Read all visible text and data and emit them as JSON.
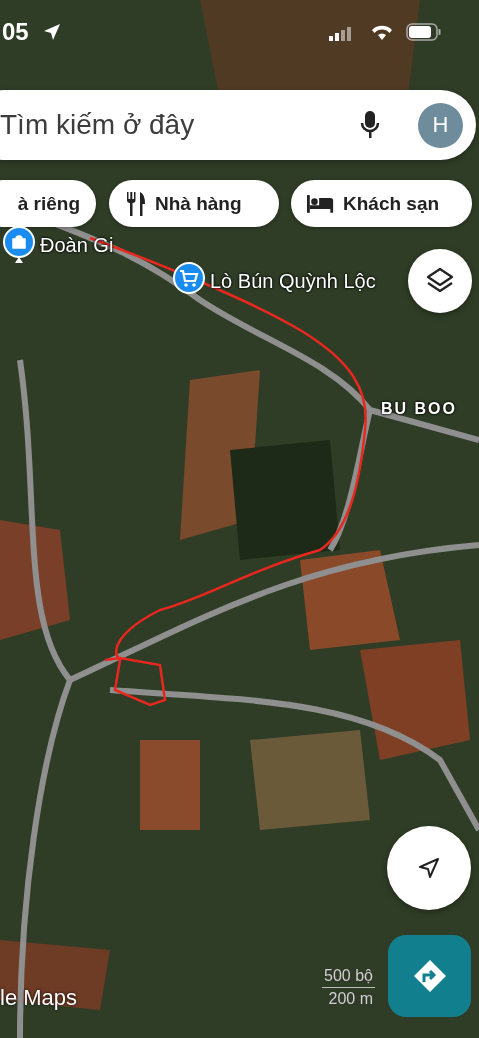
{
  "status_bar": {
    "time": "05"
  },
  "search": {
    "placeholder": "Tìm kiếm ở đây",
    "avatar_initial": "H"
  },
  "chips": [
    {
      "label": "à riêng",
      "kind": "plain"
    },
    {
      "label": "Nhà hàng",
      "kind": "restaurant"
    },
    {
      "label": "Khách sạn",
      "kind": "hotel"
    }
  ],
  "map": {
    "places": [
      {
        "name": "Đoàn Gi",
        "kind": "shopping"
      },
      {
        "name": "Lò Bún Quỳnh Lộc",
        "kind": "cart"
      },
      {
        "name": "BU BOO",
        "kind": "area"
      }
    ],
    "logo": "le Maps",
    "scale": {
      "imperial": "500 bộ",
      "metric": "200 m"
    }
  }
}
